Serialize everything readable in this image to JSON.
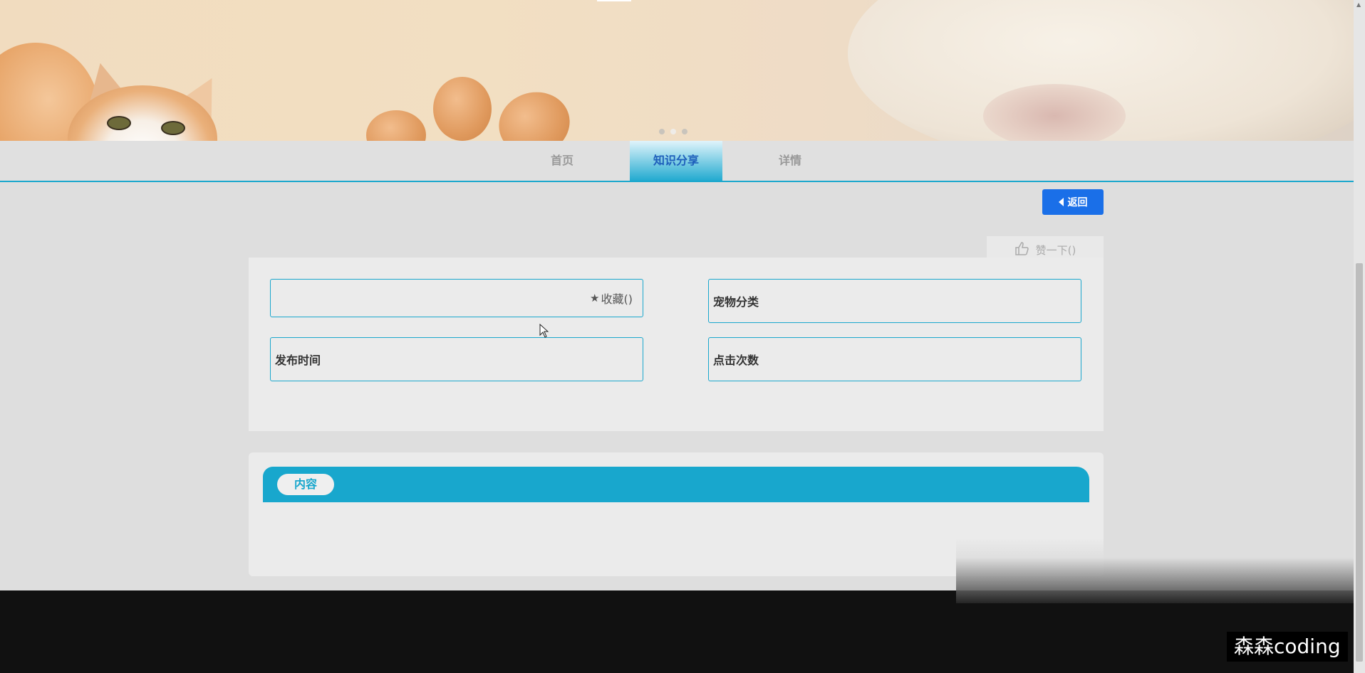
{
  "banner": {
    "carousel_dots": 3,
    "active_dot": 1
  },
  "nav": {
    "items": [
      {
        "label": "首页"
      },
      {
        "label": "知识分享",
        "active": true
      },
      {
        "label": "详情"
      }
    ]
  },
  "back_button": {
    "label": "返回",
    "icon": "caret-left-icon"
  },
  "like": {
    "label": "赞一下()",
    "icon": "thumbs-up-icon"
  },
  "detail": {
    "favorite_label": "收藏()",
    "favorite_icon": "star-icon",
    "category_label": "宠物分类",
    "publish_time_label": "发布时间",
    "clicks_label": "点击次数"
  },
  "content": {
    "tab_label": "内容"
  },
  "watermark": "森森coding",
  "colors": {
    "accent": "#1aa7cd",
    "button_blue": "#1a6fe8",
    "nav_active_text": "#1e5fbb",
    "footer": "#111111"
  }
}
